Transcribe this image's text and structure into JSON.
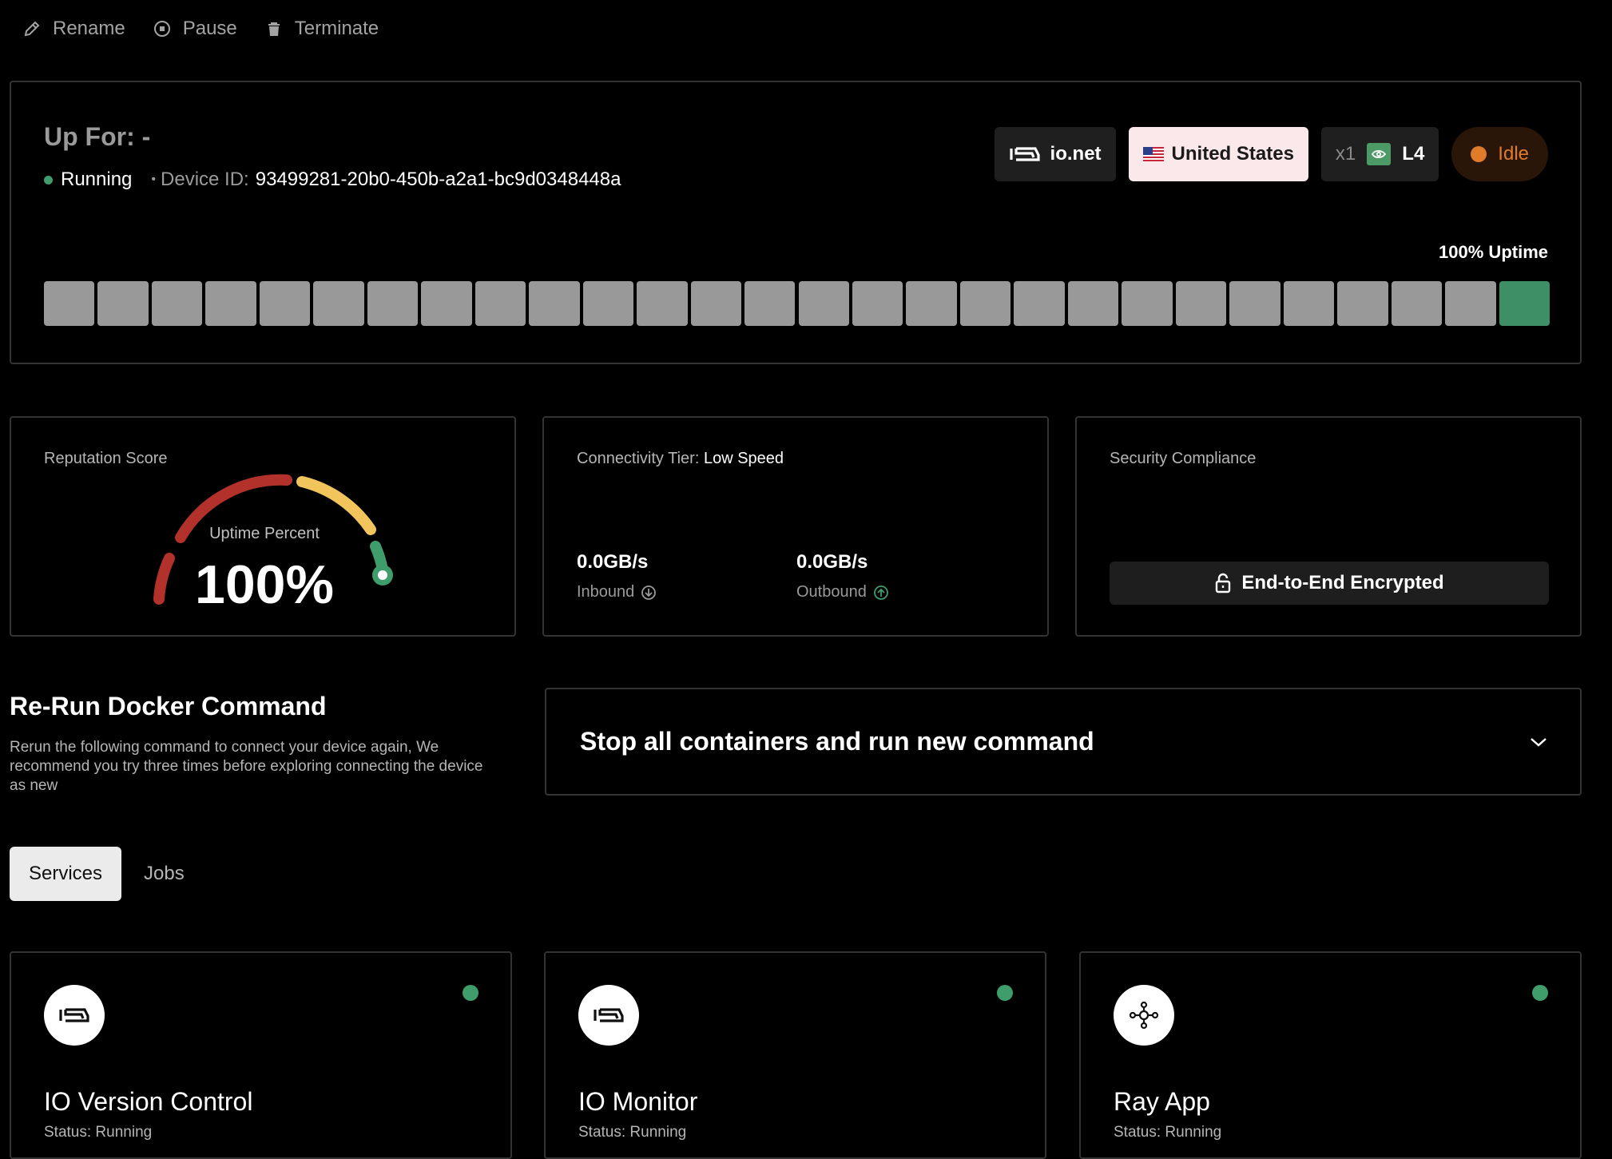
{
  "toolbar": {
    "rename": "Rename",
    "pause": "Pause",
    "terminate": "Terminate"
  },
  "device": {
    "up_for_label": "Up For:",
    "up_for_value": "-",
    "status": "Running",
    "device_id_label": "Device ID:",
    "device_id": "93499281-20b0-450b-a2a1-bc9d0348448a",
    "provider": "io.net",
    "country": "United States",
    "gpu_count": "x1",
    "gpu_model": "L4",
    "state": "Idle",
    "uptime_label": "100% Uptime",
    "uptime_bars": {
      "total": 28,
      "active_indices": [
        27
      ],
      "inactive_color": "#999999",
      "active_color": "#3f8f66"
    }
  },
  "reputation": {
    "title": "Reputation Score",
    "gauge_label": "Uptime Percent",
    "gauge_value": "100%",
    "gauge_fraction": 1.0
  },
  "connectivity": {
    "tier_label": "Connectivity Tier:",
    "tier_value": "Low Speed",
    "inbound_value": "0.0GB/s",
    "inbound_label": "Inbound",
    "outbound_value": "0.0GB/s",
    "outbound_label": "Outbound"
  },
  "security": {
    "title": "Security Compliance",
    "button": "End-to-End Encrypted"
  },
  "rerun": {
    "title": "Re-Run Docker Command",
    "description": "Rerun the following command to connect your device again, We recommend you try three times before exploring connecting the device as new",
    "selected_option": "Stop all containers and run new command"
  },
  "tabs": [
    {
      "label": "Services",
      "active": true
    },
    {
      "label": "Jobs",
      "active": false
    }
  ],
  "services": [
    {
      "name": "IO Version Control",
      "status": "Status: Running",
      "icon": "io-logo-icon"
    },
    {
      "name": "IO Monitor",
      "status": "Status: Running",
      "icon": "io-logo-icon"
    },
    {
      "name": "Ray App",
      "status": "Status: Running",
      "icon": "ray-icon"
    }
  ],
  "colors": {
    "accent_green": "#3f9d6b",
    "idle_orange": "#e07b2a",
    "gauge_red": "#b3312b",
    "gauge_yellow": "#f2c55c"
  }
}
